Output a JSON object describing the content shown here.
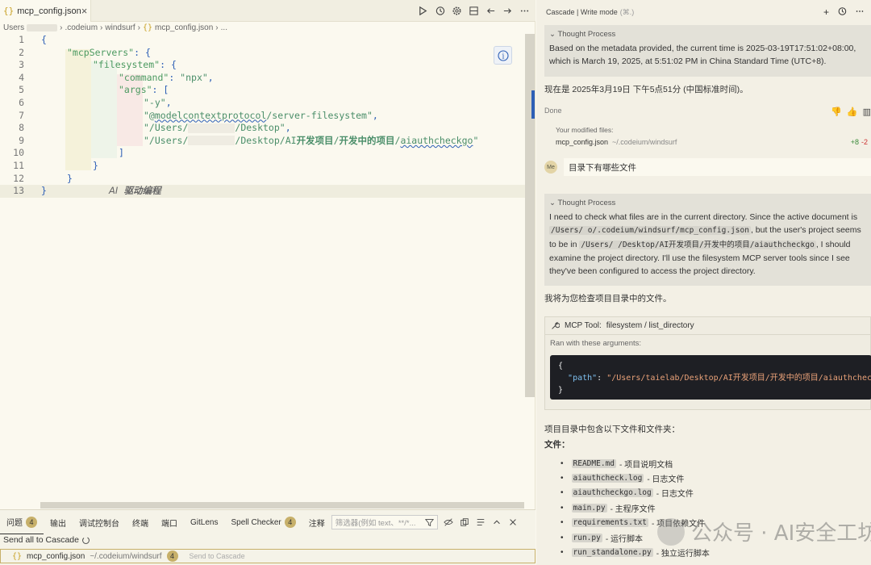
{
  "editor": {
    "tab": {
      "json_glyph": "{}",
      "filename": "mcp_config.json",
      "close_glyph": "×"
    },
    "breadcrumb": {
      "part1": "Users",
      "sep": "›",
      "part2": ".codeium",
      "part3": "windsurf",
      "json_glyph": "{}",
      "part4": "mcp_config.json",
      "part5": "..."
    },
    "code": {
      "line_numbers": [
        "1",
        "2",
        "3",
        "4",
        "5",
        "6",
        "7",
        "8",
        "9",
        "10",
        "11",
        "12",
        "13"
      ],
      "l1": "{",
      "l2_key": "\"mcpServers\"",
      "l2_rest": ": {",
      "l3_key": "\"filesystem\"",
      "l3_rest": ": {",
      "l4_key": "\"command\"",
      "l4_colon": ": ",
      "l4_val": "\"npx\"",
      "l4_comma": ",",
      "l5_key": "\"args\"",
      "l5_colon": ": ",
      "l5_bracket": "[",
      "l6_val": "\"-y\"",
      "l6_comma": ",",
      "l7_q": "\"@",
      "l7_sq": "modelcontextprotocol",
      "l7_rest": "/server-filesystem\"",
      "l7_comma": ",",
      "l8_a": "\"/Users/",
      "l8_b": "/Desktop\"",
      "l8_comma": ",",
      "l9_a": "\"/Users/",
      "l9_b": "/Desktop/AI",
      "l9_cn1": "开发项目",
      "l9_slash1": "/",
      "l9_cn2": "开发中的项目",
      "l9_slash2": "/",
      "l9_sq": "aiauthcheckgo",
      "l9_end": "\"",
      "l10": "]",
      "l11": "}",
      "l12": "}",
      "l13": "}",
      "ghost_ai": "AI",
      "ghost_cn": "驱动编程"
    },
    "info_glyph": "i"
  },
  "panel": {
    "tabs": [
      {
        "label": "问题",
        "badge": "4"
      },
      {
        "label": "输出"
      },
      {
        "label": "调试控制台"
      },
      {
        "label": "终端"
      },
      {
        "label": "端口"
      },
      {
        "label": "GitLens"
      },
      {
        "label": "Spell Checker",
        "badge": "4"
      },
      {
        "label": "注释"
      }
    ],
    "filter_placeholder": "筛选器(例如 text、**/*...",
    "send_all": "Send all to Cascade",
    "status": {
      "json_glyph": "{}",
      "file": "mcp_config.json",
      "path": "~/.codeium/windsurf",
      "badge": "4",
      "send": "Send to Cascade"
    }
  },
  "cascade": {
    "header": {
      "title": "Cascade | Write mode",
      "shortcut": "(⌘.)",
      "plus": "+"
    },
    "thought_title": "Thought Process",
    "thought1": "Based on the metadata provided, the current time is 2025-03-19T17:51:02+08:00, which is March 19, 2025, at 5:51:02 PM in China Standard Time (UTC+8).",
    "answer1": "现在是 2025年3月19日 下午5点51分 (中国标准时间)。",
    "done": "Done",
    "modified_label": "Your modified files:",
    "modified_file": "mcp_config.json",
    "modified_path": "~/.codeium/windsurf",
    "diff_add": "+8",
    "diff_del": "-2",
    "avatar": "Me",
    "user_msg": "目录下有哪些文件",
    "thought2_a": "I need to check what files are in the current directory. Since the active document is ",
    "thought2_code1": "/Users/        o/.codeium/windsurf/mcp_config.json",
    "thought2_b": ", but the user's project seems to be in ",
    "thought2_code2": "/Users/        /Desktop/AI开发项目/开发中的项目/aiauthcheckgo",
    "thought2_c": ", I should examine the project directory. I'll use the filesystem MCP server tools since I see they've been configured to access the project directory.",
    "answer2": "我将为您检查项目目录中的文件。",
    "tool": {
      "label": "MCP Tool:",
      "name": "filesystem / list_directory",
      "args_label": "Ran with these arguments:",
      "open": "{",
      "key": "\"path\"",
      "colon": ": ",
      "val": "\"/Users/taielab/Desktop/AI开发项目/开发中的项目/aiauthcheckgo\"",
      "close": "}"
    },
    "dir_intro": "项目目录中包含以下文件和文件夹：",
    "files_heading": "文件：",
    "files": [
      {
        "name": "README.md",
        "desc": "- 项目说明文档"
      },
      {
        "name": "aiauthcheck.log",
        "desc": "- 日志文件"
      },
      {
        "name": "aiauthcheckgo.log",
        "desc": "- 日志文件"
      },
      {
        "name": "main.py",
        "desc": "- 主程序文件"
      },
      {
        "name": "requirements.txt",
        "desc": "- 项目依赖文件"
      },
      {
        "name": "run.py",
        "desc": "- 运行脚本"
      },
      {
        "name": "run_standalone.py",
        "desc": "- 独立运行脚本"
      }
    ],
    "watermark": "公众号 · AI安全工坊"
  }
}
